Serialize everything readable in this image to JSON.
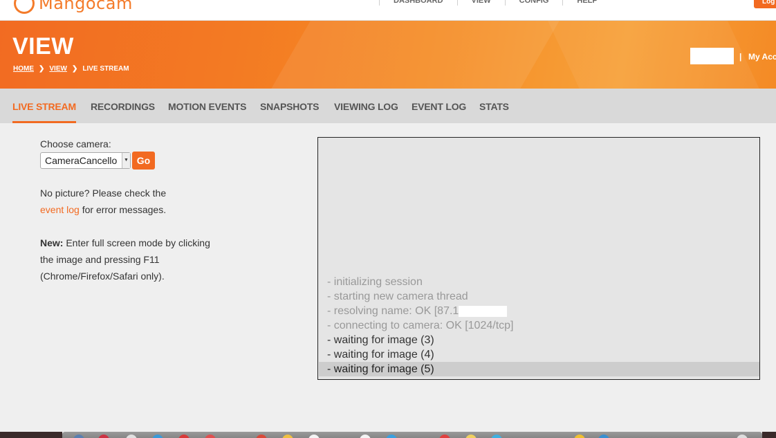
{
  "header": {
    "logo_text": "Mangocam",
    "nav": [
      "DASHBOARD",
      "VIEW",
      "CONFIG",
      "HELP"
    ],
    "logout_label": "Log"
  },
  "banner": {
    "title": "VIEW",
    "breadcrumb": [
      "HOME",
      "VIEW",
      "LIVE STREAM"
    ],
    "account_sep": "|",
    "account_link": "My Acc"
  },
  "tabs": [
    "LIVE STREAM",
    "RECORDINGS",
    "MOTION EVENTS",
    "SNAPSHOTS",
    "VIEWING LOG",
    "EVENT LOG",
    "STATS"
  ],
  "active_tab": "LIVE STREAM",
  "camera": {
    "label": "Choose camera:",
    "selected": "CameraCancello",
    "go_label": "Go"
  },
  "help": {
    "line1": "No picture? Please check the",
    "link": "event log",
    "line2_rest": " for error messages.",
    "new_label": "New:",
    "new_text": " Enter full screen mode by clicking the image and pressing F11 (Chrome/Firefox/Safari only)."
  },
  "stream_log": [
    "- initializing session",
    "- starting new camera thread",
    "- resolving name: OK [87.1",
    "- connecting to camera: OK [1024/tcp]",
    "- waiting for image (3)",
    "- waiting for image (4)",
    "- waiting for image (5)"
  ],
  "colors": {
    "accent": "#f26a21",
    "banner": "#f37a23"
  }
}
